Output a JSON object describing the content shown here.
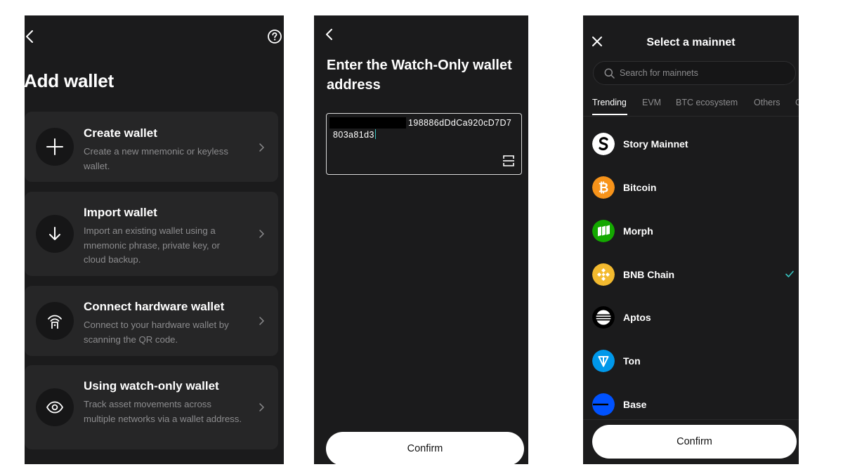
{
  "add_wallet": {
    "title": "Add wallet",
    "icons": {
      "back": "back-arrow-icon",
      "help": "help-circle-icon"
    },
    "options": [
      {
        "title": "Create wallet",
        "description": "Create a new mnemonic or keyless wallet.",
        "icon": "plus-icon"
      },
      {
        "title": "Import wallet",
        "description": "Import an existing wallet using a mnemonic phrase, private key, or cloud backup.",
        "icon": "download-arrow-icon"
      },
      {
        "title": "Connect hardware wallet",
        "description": "Connect to your hardware wallet by scanning the QR code.",
        "icon": "hardware-wallet-icon"
      },
      {
        "title": "Using watch-only wallet",
        "description": "Track asset movements across multiple networks via a wallet address.",
        "icon": "eye-icon"
      }
    ]
  },
  "watch_only": {
    "title": "Enter the Watch-Only wallet address",
    "address_line1": "198886dDdCa920cD7D7",
    "address_line2": "803a81d3",
    "confirm_label": "Confirm"
  },
  "mainnet": {
    "title": "Select a mainnet",
    "search_placeholder": "Search for mainnets",
    "tabs": [
      "Trending",
      "EVM",
      "BTC ecosystem",
      "Others",
      "C"
    ],
    "active_tab": "Trending",
    "networks": [
      {
        "name": "Story Mainnet",
        "color": "#ffffff"
      },
      {
        "name": "Bitcoin",
        "color": "#f7931a"
      },
      {
        "name": "Morph",
        "color": "#14a800"
      },
      {
        "name": "BNB Chain",
        "color": "#f3ba2f",
        "selected": true
      },
      {
        "name": "Aptos",
        "color": "#000000"
      },
      {
        "name": "Ton",
        "color": "#0098ea"
      },
      {
        "name": "Base",
        "color": "#0052ff"
      }
    ],
    "confirm_label": "Confirm",
    "accent_check": "#38c4c0"
  }
}
